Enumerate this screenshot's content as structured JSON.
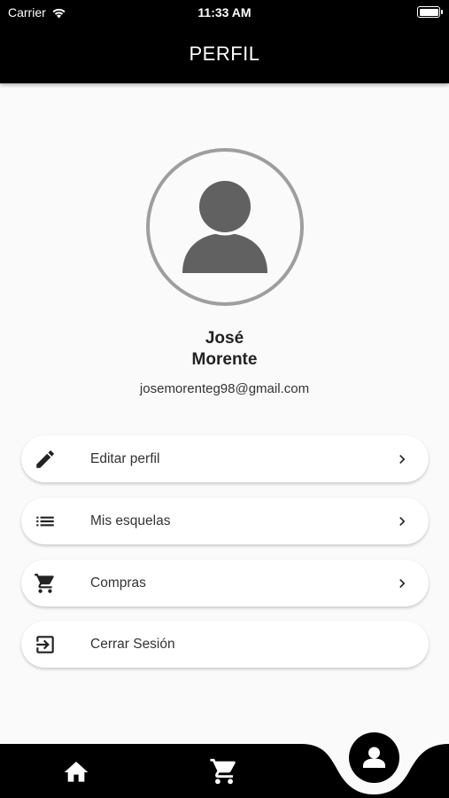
{
  "status_bar": {
    "carrier": "Carrier",
    "time": "11:33 AM",
    "icons": [
      "wifi-icon",
      "battery-icon"
    ]
  },
  "header": {
    "title": "PERFIL"
  },
  "profile": {
    "first_name": "José",
    "last_name": "Morente",
    "email": "josemorenteg98@gmail.com",
    "avatar_icon": "person-icon"
  },
  "menu": {
    "items": [
      {
        "label": "Editar perfil",
        "icon": "pencil-icon",
        "has_chevron": true
      },
      {
        "label": "Mis esquelas",
        "icon": "list-icon",
        "has_chevron": true
      },
      {
        "label": "Compras",
        "icon": "cart-icon",
        "has_chevron": true
      },
      {
        "label": "Cerrar Sesión",
        "icon": "logout-icon",
        "has_chevron": false
      }
    ]
  },
  "bottom_nav": {
    "items": [
      {
        "icon": "home-icon"
      },
      {
        "icon": "cart-icon"
      },
      {
        "icon": "person-icon",
        "active": true
      }
    ]
  },
  "colors": {
    "bar_background": "#000000",
    "page_background": "#fafafa",
    "avatar_ring": "#9e9e9e",
    "avatar_fill": "#616161"
  }
}
